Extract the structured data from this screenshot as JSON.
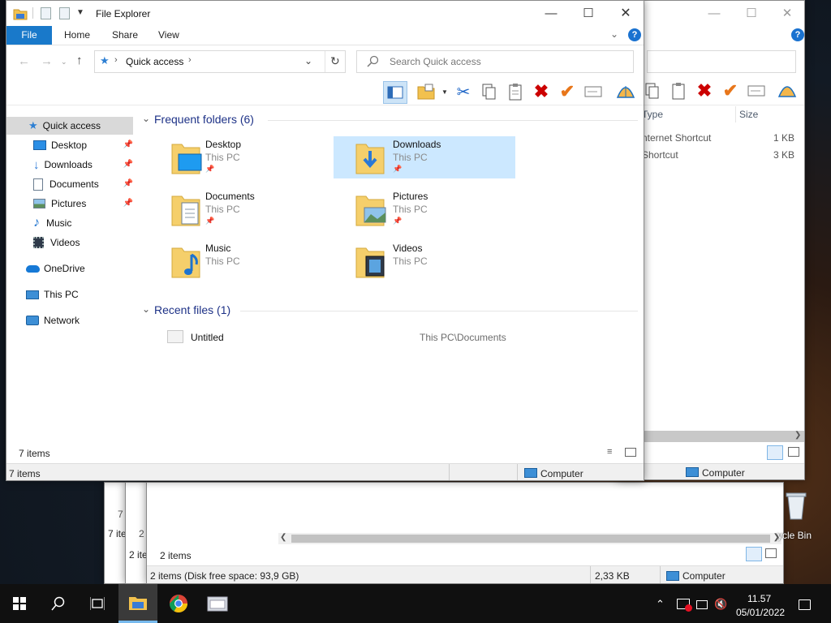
{
  "main": {
    "title": "File Explorer",
    "ribbon_tabs": [
      "File",
      "Home",
      "Share",
      "View"
    ],
    "address": {
      "location": "Quick access"
    },
    "search": {
      "placeholder": "Search Quick access"
    },
    "nav": [
      {
        "label": "Quick access",
        "icon": "star-icon"
      },
      {
        "label": "Desktop",
        "icon": "desktop-icon",
        "pinned": true
      },
      {
        "label": "Downloads",
        "icon": "download-icon",
        "pinned": true
      },
      {
        "label": "Documents",
        "icon": "document-icon",
        "pinned": true
      },
      {
        "label": "Pictures",
        "icon": "pictures-icon",
        "pinned": true
      },
      {
        "label": "Music",
        "icon": "music-icon"
      },
      {
        "label": "Videos",
        "icon": "videos-icon"
      },
      {
        "label": "OneDrive",
        "icon": "cloud-icon"
      },
      {
        "label": "This PC",
        "icon": "computer-icon"
      },
      {
        "label": "Network",
        "icon": "network-icon"
      }
    ],
    "frequent": {
      "heading": "Frequent folders (6)",
      "items": [
        {
          "name": "Desktop",
          "location": "This PC",
          "pinned": true
        },
        {
          "name": "Downloads",
          "location": "This PC",
          "pinned": true,
          "selected": true
        },
        {
          "name": "Documents",
          "location": "This PC",
          "pinned": true
        },
        {
          "name": "Pictures",
          "location": "This PC",
          "pinned": true
        },
        {
          "name": "Music",
          "location": "This PC"
        },
        {
          "name": "Videos",
          "location": "This PC"
        }
      ]
    },
    "recent": {
      "heading": "Recent files (1)",
      "items": [
        {
          "name": "Untitled",
          "path": "This PC\\Documents"
        }
      ]
    },
    "status_inner": "7 items",
    "status_outer": "7 items",
    "status_location": "Computer"
  },
  "back_window": {
    "columns": [
      "Type",
      "Size"
    ],
    "rows": [
      {
        "type": "nternet Shortcut",
        "size": "1 KB"
      },
      {
        "type": "Shortcut",
        "size": "3 KB"
      }
    ],
    "status_location": "Computer"
  },
  "bottom_window": {
    "items_count": "2 items",
    "status_text": "2 items (Disk free space: 93,9 GB)",
    "size": "2,33 KB",
    "location": "Computer",
    "fragment_a": "7 i",
    "fragment_b": "7 ite",
    "fragment_c": "2 i",
    "fragment_d": "2 ite"
  },
  "desktop": {
    "recycle_label": "ycle Bin"
  },
  "taskbar": {
    "time": "11.57",
    "date": "05/01/2022"
  },
  "colors": {
    "accent": "#0063b1",
    "selection": "#cce8ff",
    "taskbar": "#101010"
  }
}
